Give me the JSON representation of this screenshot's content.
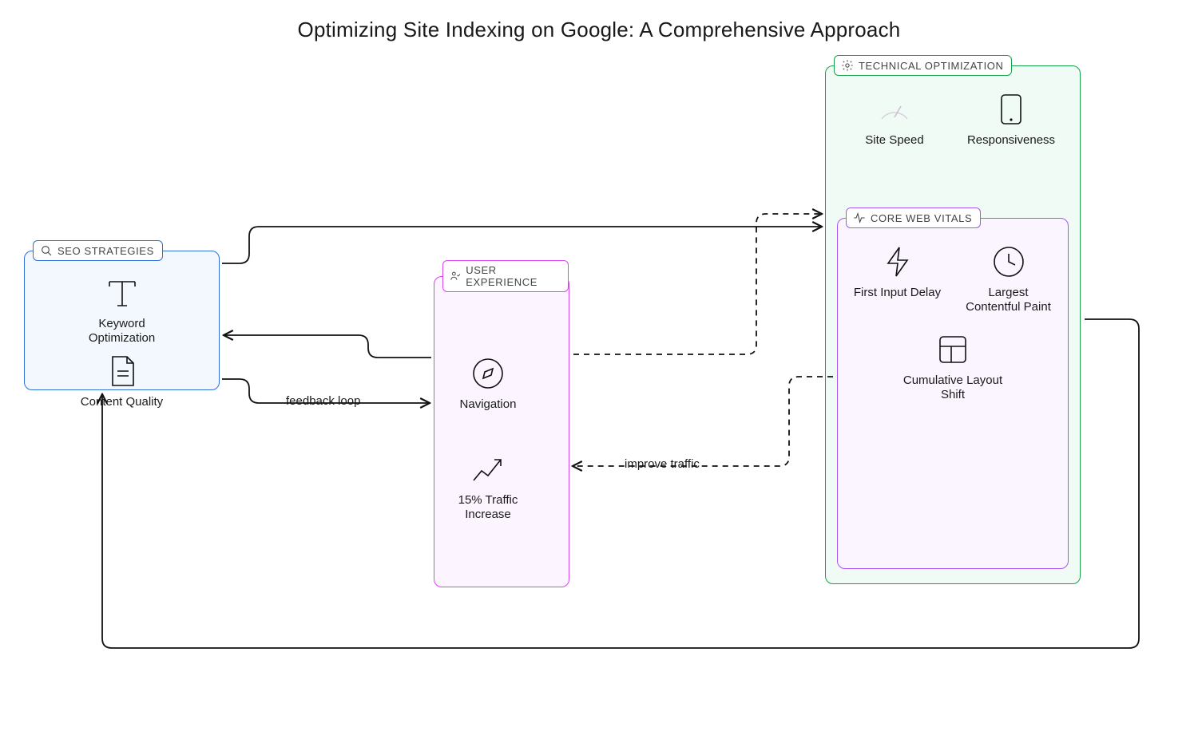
{
  "title": "Optimizing Site Indexing on Google: A Comprehensive Approach",
  "seo": {
    "label": "SEO STRATEGIES",
    "keyword": "Keyword Optimization",
    "content": "Content Quality"
  },
  "ux": {
    "label": "USER EXPERIENCE",
    "nav": "Navigation",
    "traffic": "15% Traffic Increase"
  },
  "tech": {
    "label": "TECHNICAL OPTIMIZATION",
    "speed": "Site Speed",
    "responsive": "Responsiveness"
  },
  "cwv": {
    "label": "CORE WEB VITALS",
    "fid": "First Input Delay",
    "lcp": "Largest Contentful Paint",
    "cls": "Cumulative Layout Shift"
  },
  "edges": {
    "feedback": "feedback loop",
    "improve": "improve traffic"
  }
}
